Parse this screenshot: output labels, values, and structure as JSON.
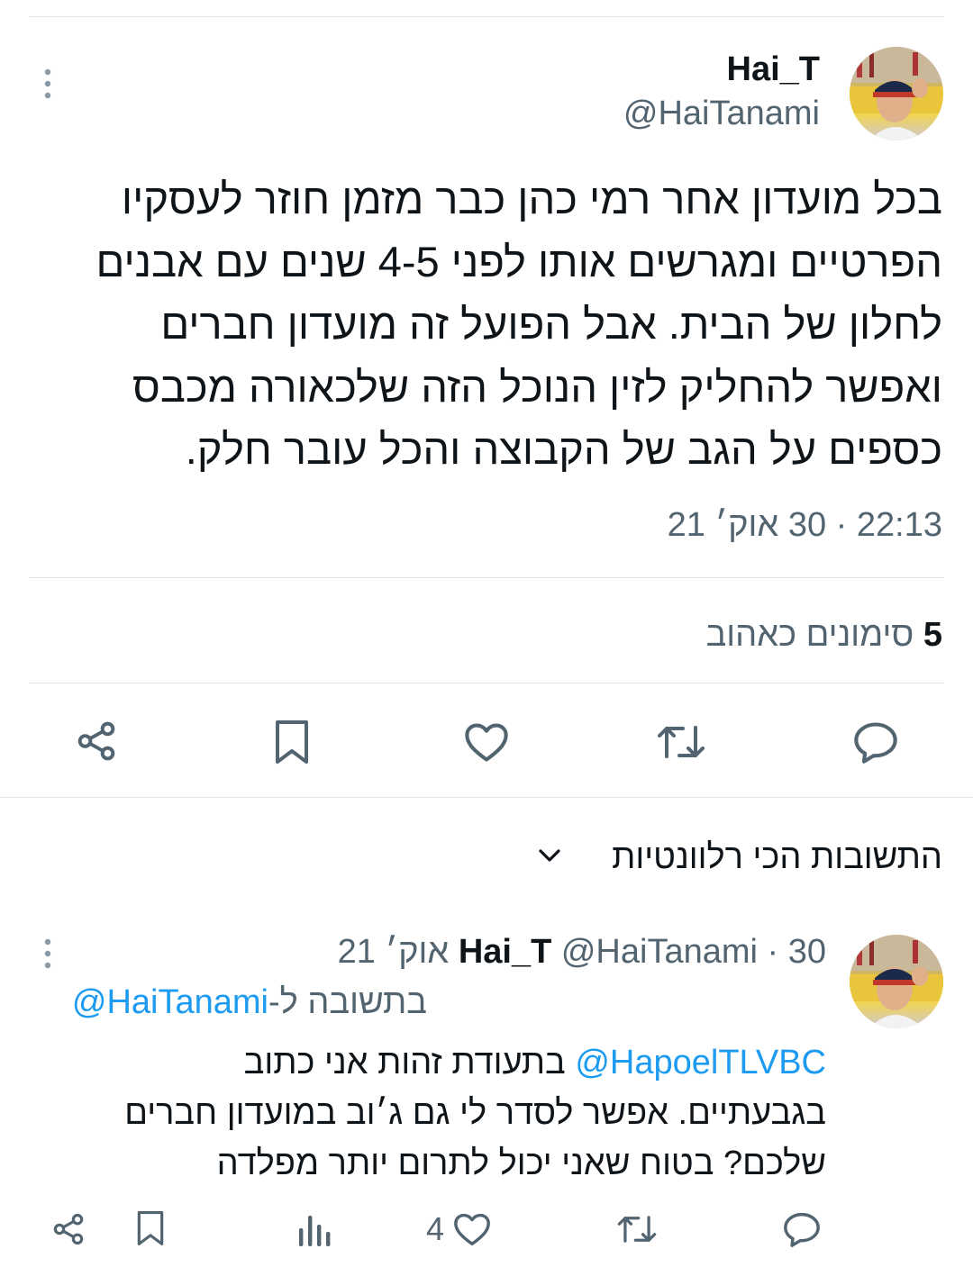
{
  "tweet": {
    "display_name": "Hai_T",
    "handle": "@HaiTanami",
    "body_lines": [
      "בכל מועדון אחר רמי כהן כבר מזמן חוזר לעסקיו",
      "הפרטיים ומגרשים אותו לפני 4-5 שנים עם אבנים",
      "לחלון של הבית. אבל הפועל זה מועדון חברים",
      "ואפשר להחליק לזין הנוכל הזה שלכאורה מכבס",
      "כספים על הגב של הקבוצה והכל עובר חלק."
    ],
    "timestamp": "22:13 · 30 אוק׳ 21",
    "likes_count": "5",
    "likes_label": "סימונים כאהוב"
  },
  "replies_sort": {
    "label": "התשובות הכי רלוונטיות"
  },
  "reply": {
    "display_name": "Hai_T",
    "handle": "@HaiTanami",
    "date": "· 30 אוק׳ 21",
    "replying_to_prefix": "בתשובה ל-",
    "replying_to_handle": "@HaiTanami",
    "mention": "@HapoelTLVBC",
    "line1_rest": "בתעודת זהות אני כתוב",
    "line2": "בגבעתיים. אפשר לסדר לי גם ג׳וב במועדון חברים",
    "line3": "שלכם? בטוח שאני יכול לתרום יותר מפלדה",
    "like_count": "4"
  },
  "icons": {
    "more": "more-vertical-icon",
    "reply": "reply-bubble-icon",
    "retweet": "retweet-icon",
    "like": "heart-icon",
    "bookmark": "bookmark-icon",
    "share": "share-icon",
    "views": "views-bars-icon",
    "chevron": "chevron-down-icon"
  },
  "colors": {
    "text": "#0f1419",
    "secondary": "#536471",
    "link": "#1d9bf0",
    "divider": "#e1e6ea"
  }
}
